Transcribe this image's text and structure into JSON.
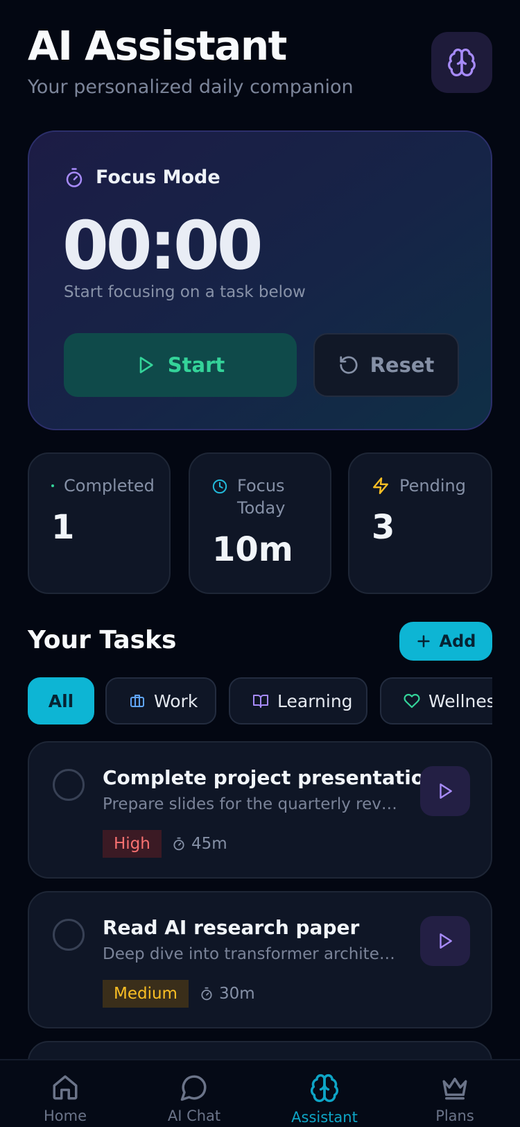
{
  "header": {
    "title": "AI Assistant",
    "subtitle": "Your personalized daily companion",
    "brain_icon": "brain-icon"
  },
  "focus": {
    "label": "Focus Mode",
    "timer": "00:00",
    "hint": "Start focusing on a task below",
    "start_label": "Start",
    "reset_label": "Reset",
    "icon": "stopwatch-icon"
  },
  "stats": [
    {
      "label": "Completed",
      "value": "1",
      "icon": "check-icon"
    },
    {
      "label": "Focus Today",
      "value": "10m",
      "icon": "clock-icon"
    },
    {
      "label": "Pending",
      "value": "3",
      "icon": "lightning-icon"
    }
  ],
  "tasks_section": {
    "title": "Your Tasks",
    "add_label": "Add"
  },
  "filters": [
    {
      "label": "All",
      "active": true
    },
    {
      "label": "Work",
      "icon": "briefcase-icon"
    },
    {
      "label": "Learning",
      "icon": "book-icon"
    },
    {
      "label": "Wellness",
      "icon": "heart-icon"
    }
  ],
  "tasks": [
    {
      "title": "Complete project presentation",
      "description": "Prepare slides for the quarterly review",
      "priority": "High",
      "duration": "45m"
    },
    {
      "title": "Read AI research paper",
      "description": "Deep dive into transformer architectures",
      "priority": "Medium",
      "duration": "30m"
    }
  ],
  "nav": [
    {
      "label": "Home",
      "icon": "home-icon"
    },
    {
      "label": "AI Chat",
      "icon": "chat-icon"
    },
    {
      "label": "Assistant",
      "icon": "brain-icon",
      "active": true
    },
    {
      "label": "Plans",
      "icon": "crown-icon"
    }
  ],
  "colors": {
    "background": "#030712",
    "accent_cyan": "#0db5d4",
    "start_green": "#34d399",
    "high_priority": "#f87171",
    "medium_priority": "#fbbf24",
    "purple_icon": "#a78bfa"
  }
}
